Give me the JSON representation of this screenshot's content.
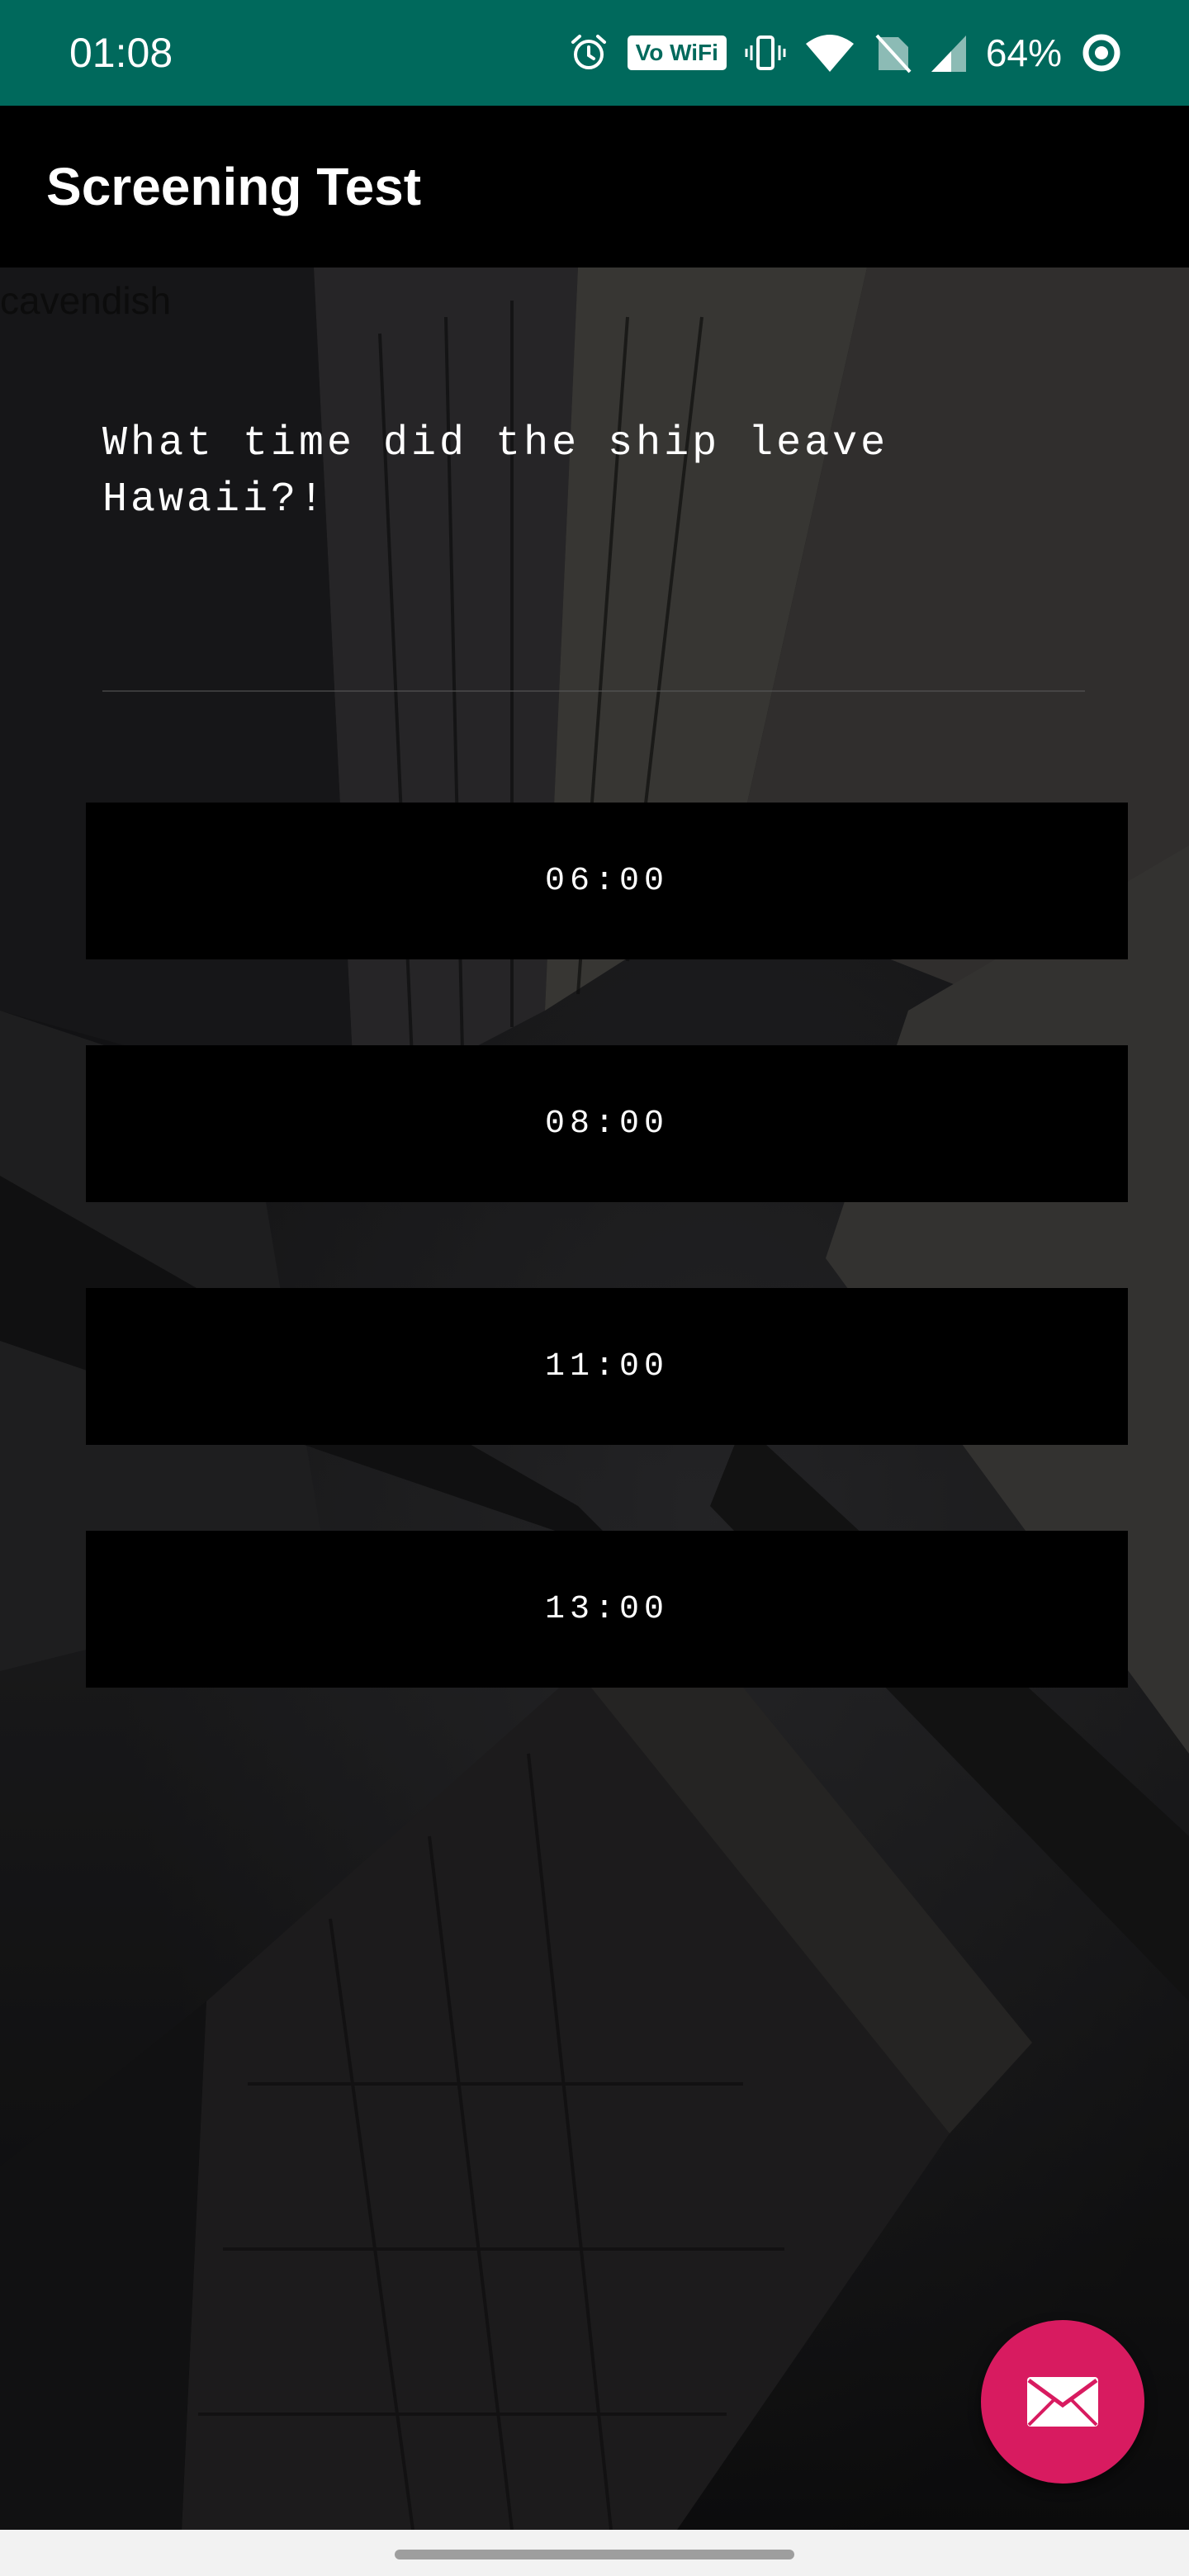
{
  "status_bar": {
    "time": "01:08",
    "wifi_label": "Vo WiFi",
    "battery_percent": "64%",
    "icons": [
      "alarm-icon",
      "vowifi-badge",
      "vibrate-icon",
      "wifi-icon",
      "no-sim-icon",
      "cell-signal-icon",
      "battery-ring-icon"
    ]
  },
  "app_bar": {
    "title": "Screening Test"
  },
  "content": {
    "ghost_label": "cavendish",
    "question": "What time did the ship leave Hawaii?!",
    "options": [
      "06:00",
      "08:00",
      "11:00",
      "13:00"
    ]
  },
  "fab": {
    "icon": "email-icon",
    "color": "#d81b60"
  },
  "colors": {
    "status_bar": "#00695c",
    "app_bar": "#000000",
    "option_bg": "#000000",
    "accent": "#d81b60"
  }
}
